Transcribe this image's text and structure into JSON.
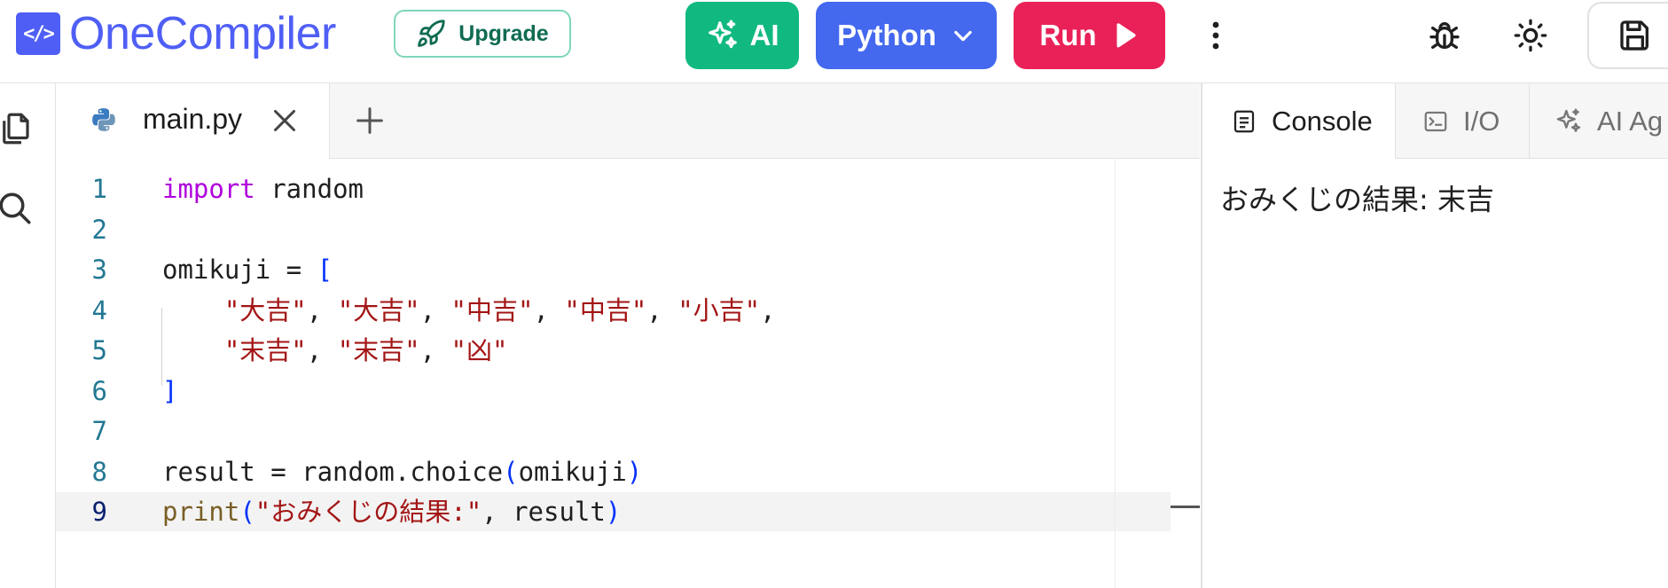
{
  "header": {
    "logo_glyph": "</>",
    "logo_text": "OneCompiler",
    "upgrade_label": "Upgrade",
    "ai_label": "AI",
    "language_label": "Python",
    "run_label": "Run"
  },
  "editor": {
    "tab_label": "main.py",
    "lines": [
      {
        "n": "1",
        "tokens": [
          {
            "t": "import",
            "c": "kw"
          },
          {
            "t": " random",
            "c": "txt"
          }
        ]
      },
      {
        "n": "2",
        "tokens": []
      },
      {
        "n": "3",
        "tokens": [
          {
            "t": "omikuji = ",
            "c": "txt"
          },
          {
            "t": "[",
            "c": "br"
          }
        ]
      },
      {
        "n": "4",
        "tokens": [
          {
            "t": "    ",
            "c": "txt"
          },
          {
            "t": "\"大吉\"",
            "c": "str"
          },
          {
            "t": ", ",
            "c": "txt"
          },
          {
            "t": "\"大吉\"",
            "c": "str"
          },
          {
            "t": ", ",
            "c": "txt"
          },
          {
            "t": "\"中吉\"",
            "c": "str"
          },
          {
            "t": ", ",
            "c": "txt"
          },
          {
            "t": "\"中吉\"",
            "c": "str"
          },
          {
            "t": ", ",
            "c": "txt"
          },
          {
            "t": "\"小吉\"",
            "c": "str"
          },
          {
            "t": ",",
            "c": "txt"
          }
        ]
      },
      {
        "n": "5",
        "tokens": [
          {
            "t": "    ",
            "c": "txt"
          },
          {
            "t": "\"末吉\"",
            "c": "str"
          },
          {
            "t": ", ",
            "c": "txt"
          },
          {
            "t": "\"末吉\"",
            "c": "str"
          },
          {
            "t": ", ",
            "c": "txt"
          },
          {
            "t": "\"凶\"",
            "c": "str"
          }
        ]
      },
      {
        "n": "6",
        "tokens": [
          {
            "t": "]",
            "c": "br"
          }
        ]
      },
      {
        "n": "7",
        "tokens": []
      },
      {
        "n": "8",
        "tokens": [
          {
            "t": "result = random.choice",
            "c": "txt"
          },
          {
            "t": "(",
            "c": "br"
          },
          {
            "t": "omikuji",
            "c": "txt"
          },
          {
            "t": ")",
            "c": "br"
          }
        ]
      },
      {
        "n": "9",
        "tokens": [
          {
            "t": "print",
            "c": "fn"
          },
          {
            "t": "(",
            "c": "br"
          },
          {
            "t": "\"おみくじの結果:\"",
            "c": "str"
          },
          {
            "t": ", result",
            "c": "txt"
          },
          {
            "t": ")",
            "c": "br"
          }
        ]
      }
    ],
    "active_line": "9"
  },
  "right_panel": {
    "tabs": [
      {
        "label": "Console",
        "icon": "console-icon",
        "active": true
      },
      {
        "label": "I/O",
        "icon": "terminal-icon",
        "active": false
      },
      {
        "label": "AI Ag",
        "icon": "sparkle-icon",
        "active": false
      }
    ],
    "console_output": "おみくじの結果: 末吉"
  },
  "colors": {
    "brand": "#4f5ff5",
    "ai_button": "#11b981",
    "language_button": "#4468ee",
    "run_button": "#ea2158",
    "keyword": "#af00db",
    "string": "#a31515",
    "bracket": "#0431fa",
    "function": "#795e26",
    "line_number": "#237893"
  }
}
